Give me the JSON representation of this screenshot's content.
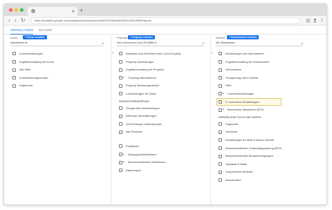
{
  "browser": {
    "url": "https://analytics.google.com/analytics/web/provision#/a28128158w54542542/p28128869/admin",
    "tab_close": "×",
    "new_tab": "+",
    "nav": {
      "back": "‹",
      "forward": "›",
      "reload": "↻"
    }
  },
  "app_tabs": [
    "VERWALTUNG",
    "NUTZER"
  ],
  "columns": {
    "account": {
      "title": "Konto",
      "create_label": "+ Konto erstellen",
      "selected": "jobsnaffirmfe.de"
    },
    "property": {
      "title": "Property",
      "create_label": "+ Property erstellen",
      "selected": "Mein Unternehmen (UA-28128869-1)"
    },
    "view": {
      "title": "Ansicht",
      "create_label": "+ Datenansicht erstellen",
      "selected": "Alle Websitedaten"
    }
  },
  "account_items": [
    {
      "label": "Kontoeinstellungen",
      "icon": "building-icon"
    },
    {
      "label": "Zugriffsverwaltung für Konto",
      "icon": "people-icon"
    },
    {
      "label": "Alle Filter",
      "icon": "filter-icon"
    },
    {
      "label": "Kontoänderungsverlauf",
      "icon": "history-icon"
    },
    {
      "label": "Papierkorb",
      "icon": "trash-icon"
    }
  ],
  "property_items": [
    {
      "label": "Assistent zum Einrichten einer GA4-Property",
      "icon": "check-icon"
    },
    {
      "label": "Property-Einstellungen",
      "icon": "square-icon"
    },
    {
      "label": "Zugriffsverwaltung für Property",
      "icon": "people-icon"
    },
    {
      "label": "Tracking-Informationen",
      "icon": "code-icon",
      "expand": "▸"
    },
    {
      "label": "Property-Änderungsverlauf",
      "icon": "history-icon"
    },
    {
      "label": "Löschanfragen für Daten",
      "icon": "delete-data-icon"
    }
  ],
  "property_section": "PRODUKTVERKNÜPFUNG",
  "property_link_items": [
    {
      "label": "Google Ads-Verknüpfungen",
      "icon": "ads-icon"
    },
    {
      "label": "AdSense-Verknüpfungen",
      "icon": "adsense-icon"
    },
    {
      "label": "Ad Exchange-Verknüpfungen",
      "icon": "adexchange-icon"
    },
    {
      "label": "Alle Produkte",
      "icon": "grid-icon"
    }
  ],
  "property_misc_items": [
    {
      "label": "Postbacks",
      "icon": "postback-icon"
    },
    {
      "label": "Zielgruppendefinitionen",
      "icon": "audience-icon",
      "expand": "▸"
    },
    {
      "label": "Benutzerdefinierte Definitionen",
      "icon": "dimension-icon",
      "expand": "▸"
    },
    {
      "label": "Datenimport",
      "icon": "upload-icon"
    }
  ],
  "view_items": [
    {
      "label": "Einstellungen der Datenansicht",
      "icon": "document-icon"
    },
    {
      "label": "Zugriffsverwaltung für Datenansicht",
      "icon": "people-icon"
    },
    {
      "label": "Zielvorhaben",
      "icon": "flag-icon"
    },
    {
      "label": "Gruppierung nach Content",
      "icon": "content-icon"
    },
    {
      "label": "Filter",
      "icon": "filter-icon"
    },
    {
      "label": "Channeleinstellungen",
      "icon": "channel-icon",
      "expand": "▸"
    },
    {
      "label": "E-Commerce-Einstellungen",
      "icon": "cart-icon",
      "highlighted": true
    },
    {
      "label": "Berechnete Messwerte BETA",
      "icon": "calc-icon",
      "expand": "▸"
    }
  ],
  "view_section": "PERSÖNLICHE TOOLS UND ASSETS",
  "view_personal_items": [
    {
      "label": "Segmente",
      "icon": "segment-icon"
    },
    {
      "label": "Vermerke",
      "icon": "note-icon"
    },
    {
      "label": "Einstellungen für Multi-Channel-Trichter",
      "icon": "chart-icon"
    },
    {
      "label": "Benutzerdefinierte Channelgruppierung BETA",
      "icon": "channel-icon"
    },
    {
      "label": "Benutzerdefinierte Benachrichtigungen",
      "icon": "bell-icon"
    },
    {
      "label": "Geplante E-Mails",
      "icon": "calendar-icon"
    },
    {
      "label": "Gespeicherte Berichte",
      "icon": "report-icon"
    },
    {
      "label": "Assets teilen",
      "icon": "share-icon"
    }
  ],
  "colors": {
    "accent": "#1a73e8",
    "highlight_border": "#e3c76b"
  }
}
